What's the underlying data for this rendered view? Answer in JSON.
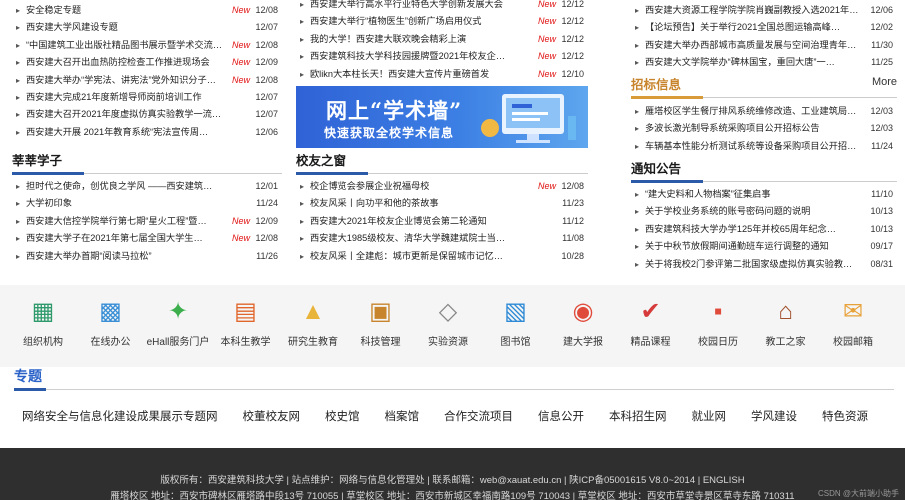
{
  "left_top_news": [
    {
      "title": "安全稳定专题",
      "new": "New",
      "date": "12/08"
    },
    {
      "title": "西安建大学风建设专题",
      "new": "",
      "date": "12/07"
    },
    {
      "title": "“中国建筑工业出版社精品图书展示暨学术交流中…",
      "new": "New",
      "date": "12/08"
    },
    {
      "title": "西安建大召开出血热防控检查工作推进现场会",
      "new": "New",
      "date": "12/09"
    },
    {
      "title": "西安建大举办“学宪法、讲宪法”党外知识分子宪…",
      "new": "New",
      "date": "12/08"
    },
    {
      "title": "西安建大完成21年度新增导师岗前培训工作",
      "new": "",
      "date": "12/07"
    },
    {
      "title": "西安建大召开2021年度虚拟仿真实验教学一流…",
      "new": "",
      "date": "12/07"
    },
    {
      "title": "西安建大开展 2021年教育系统“宪法宣传周…",
      "new": "",
      "date": "12/06"
    }
  ],
  "mid_top_news": [
    {
      "title": "西安建大举行高水平行业特色大学创新发展大会",
      "new": "New",
      "date": "12/12"
    },
    {
      "title": "西安建大举行“植物医生”创新广场启用仪式",
      "new": "New",
      "date": "12/12"
    },
    {
      "title": "我的大学！西安建大联欢晚会精彩上演",
      "new": "New",
      "date": "12/12"
    },
    {
      "title": "西安建筑科技大学科技园援牌暨2021年校友企业…",
      "new": "New",
      "date": "12/12"
    },
    {
      "title": "欧likn大本柱长天！西安建大宣传片重磅首发",
      "new": "New",
      "date": "12/10"
    }
  ],
  "right_top_news": [
    {
      "title": "西安建大资源工程学院学院肖巍副教授入选2021年…",
      "new": "",
      "date": "12/06"
    },
    {
      "title": "【论坛预告】关于举行2021全国总图运输高峰…",
      "new": "",
      "date": "12/02"
    },
    {
      "title": "西安建大举办西部城市高质量发展与空间治理青年…",
      "new": "",
      "date": "11/30"
    },
    {
      "title": "西安建大文学院举办“碑林国宝，重回大唐”一…",
      "new": "",
      "date": "11/25"
    }
  ],
  "banner": {
    "title": "网上“学术墙”",
    "subtitle": "快速获取全校学术信息"
  },
  "sections": {
    "huahua": "莘莘学子",
    "alumni": "校友之窗",
    "bidding": "招标信息",
    "notice": "通知公告",
    "more": "More"
  },
  "huahua_news": [
    {
      "title": "担时代之使命，创优良之学风 ——西安建筑…",
      "new": "",
      "date": "12/01"
    },
    {
      "title": "大学初印象",
      "new": "",
      "date": "11/24"
    },
    {
      "title": "西安建大信控学院举行第七期“星火工程”暨…",
      "new": "New",
      "date": "12/09"
    },
    {
      "title": "西安建大学子在2021年第七届全国大学生…",
      "new": "New",
      "date": "12/08"
    },
    {
      "title": "西安建大举办首期“阅读马拉松”",
      "new": "",
      "date": "11/26"
    }
  ],
  "alumni_news": [
    {
      "title": "校企博览会参展企业祝福母校",
      "new": "New",
      "date": "12/08"
    },
    {
      "title": "校友风采丨向功平和他的茶故事",
      "new": "",
      "date": "11/23"
    },
    {
      "title": "西安建大2021年校友企业博览会第二轮通知",
      "new": "",
      "date": "11/12"
    },
    {
      "title": "西安建大1985级校友、清华大学魏建斌院士当…",
      "new": "",
      "date": "11/08"
    },
    {
      "title": "校友风采丨全建彪：城市更新是保留城市记忆…",
      "new": "",
      "date": "10/28"
    }
  ],
  "bidding_news": [
    {
      "title": "雁塔校区学生餐厅排风系统维修改造、工业建筑局…",
      "new": "",
      "date": "12/03"
    },
    {
      "title": "多波长激光制导系统采购项目公开招标公告",
      "new": "",
      "date": "12/03"
    },
    {
      "title": "车辆基本性能分析测试系统等设备采购项目公开招…",
      "new": "",
      "date": "11/24"
    }
  ],
  "notice_news": [
    {
      "title": "“建大史料和人物档案”征集启事",
      "new": "",
      "date": "11/10"
    },
    {
      "title": "关于学校业务系统的账号密码问题的说明",
      "new": "",
      "date": "10/13"
    },
    {
      "title": "西安建筑科技大学办学125年并校65周年纪念…",
      "new": "",
      "date": "10/13"
    },
    {
      "title": "关于中秋节放假期间通勤班车运行调整的通知",
      "new": "",
      "date": "09/17"
    },
    {
      "title": "关于将我校2门参评第二批国家级虚拟仿真实验教…",
      "new": "",
      "date": "08/31"
    }
  ],
  "quick_links": [
    {
      "label": "组织机构",
      "icon": "org-chart-icon",
      "color": "#2e9a6c"
    },
    {
      "label": "在线办公",
      "icon": "monitor-icon",
      "color": "#3a8fd6"
    },
    {
      "label": "eHall服务门户",
      "icon": "compass-icon",
      "color": "#3cae4c"
    },
    {
      "label": "本科生教学",
      "icon": "books-icon",
      "color": "#e0662c"
    },
    {
      "label": "研究生教育",
      "icon": "graduate-icon",
      "color": "#e8b43a"
    },
    {
      "label": "科技管理",
      "icon": "screen-icon",
      "color": "#c8842c"
    },
    {
      "label": "实验资源",
      "icon": "lab-icon",
      "color": "#888888"
    },
    {
      "label": "图书馆",
      "icon": "library-icon",
      "color": "#2e8ad6"
    },
    {
      "label": "建大学报",
      "icon": "newspaper-icon",
      "color": "#e04a3a"
    },
    {
      "label": "精品课程",
      "icon": "course-icon",
      "color": "#d63a3a"
    },
    {
      "label": "校园日历",
      "icon": "calendar-icon",
      "color": "#e04a3a"
    },
    {
      "label": "教工之家",
      "icon": "house-icon",
      "color": "#a0522d"
    },
    {
      "label": "校园邮箱",
      "icon": "mail-icon",
      "color": "#e8a23a"
    }
  ],
  "topics": {
    "heading": "专题",
    "links": [
      "网络安全与信息化建设成果展示专题网",
      "校董校友网",
      "校史馆",
      "档案馆",
      "合作交流项目",
      "信息公开",
      "本科招生网",
      "就业网",
      "学风建设",
      "特色资源"
    ]
  },
  "footer": {
    "line1": "版权所有：西安建筑科技大学 | 站点维护：网络与信息化管理处 | 联系邮箱：web@xauat.edu.cn | 陕ICP备05001615 V8.0~2014 | ENGLISH",
    "line2": "雁塔校区 地址：西安市碑林区雁塔路中段13号 710055 | 草堂校区 地址：西安市新城区幸福南路109号 710043 | 草堂校区 地址：西安市草堂寺景区草寺东路 710311",
    "watermark": "CSDN @大前端小助手"
  }
}
